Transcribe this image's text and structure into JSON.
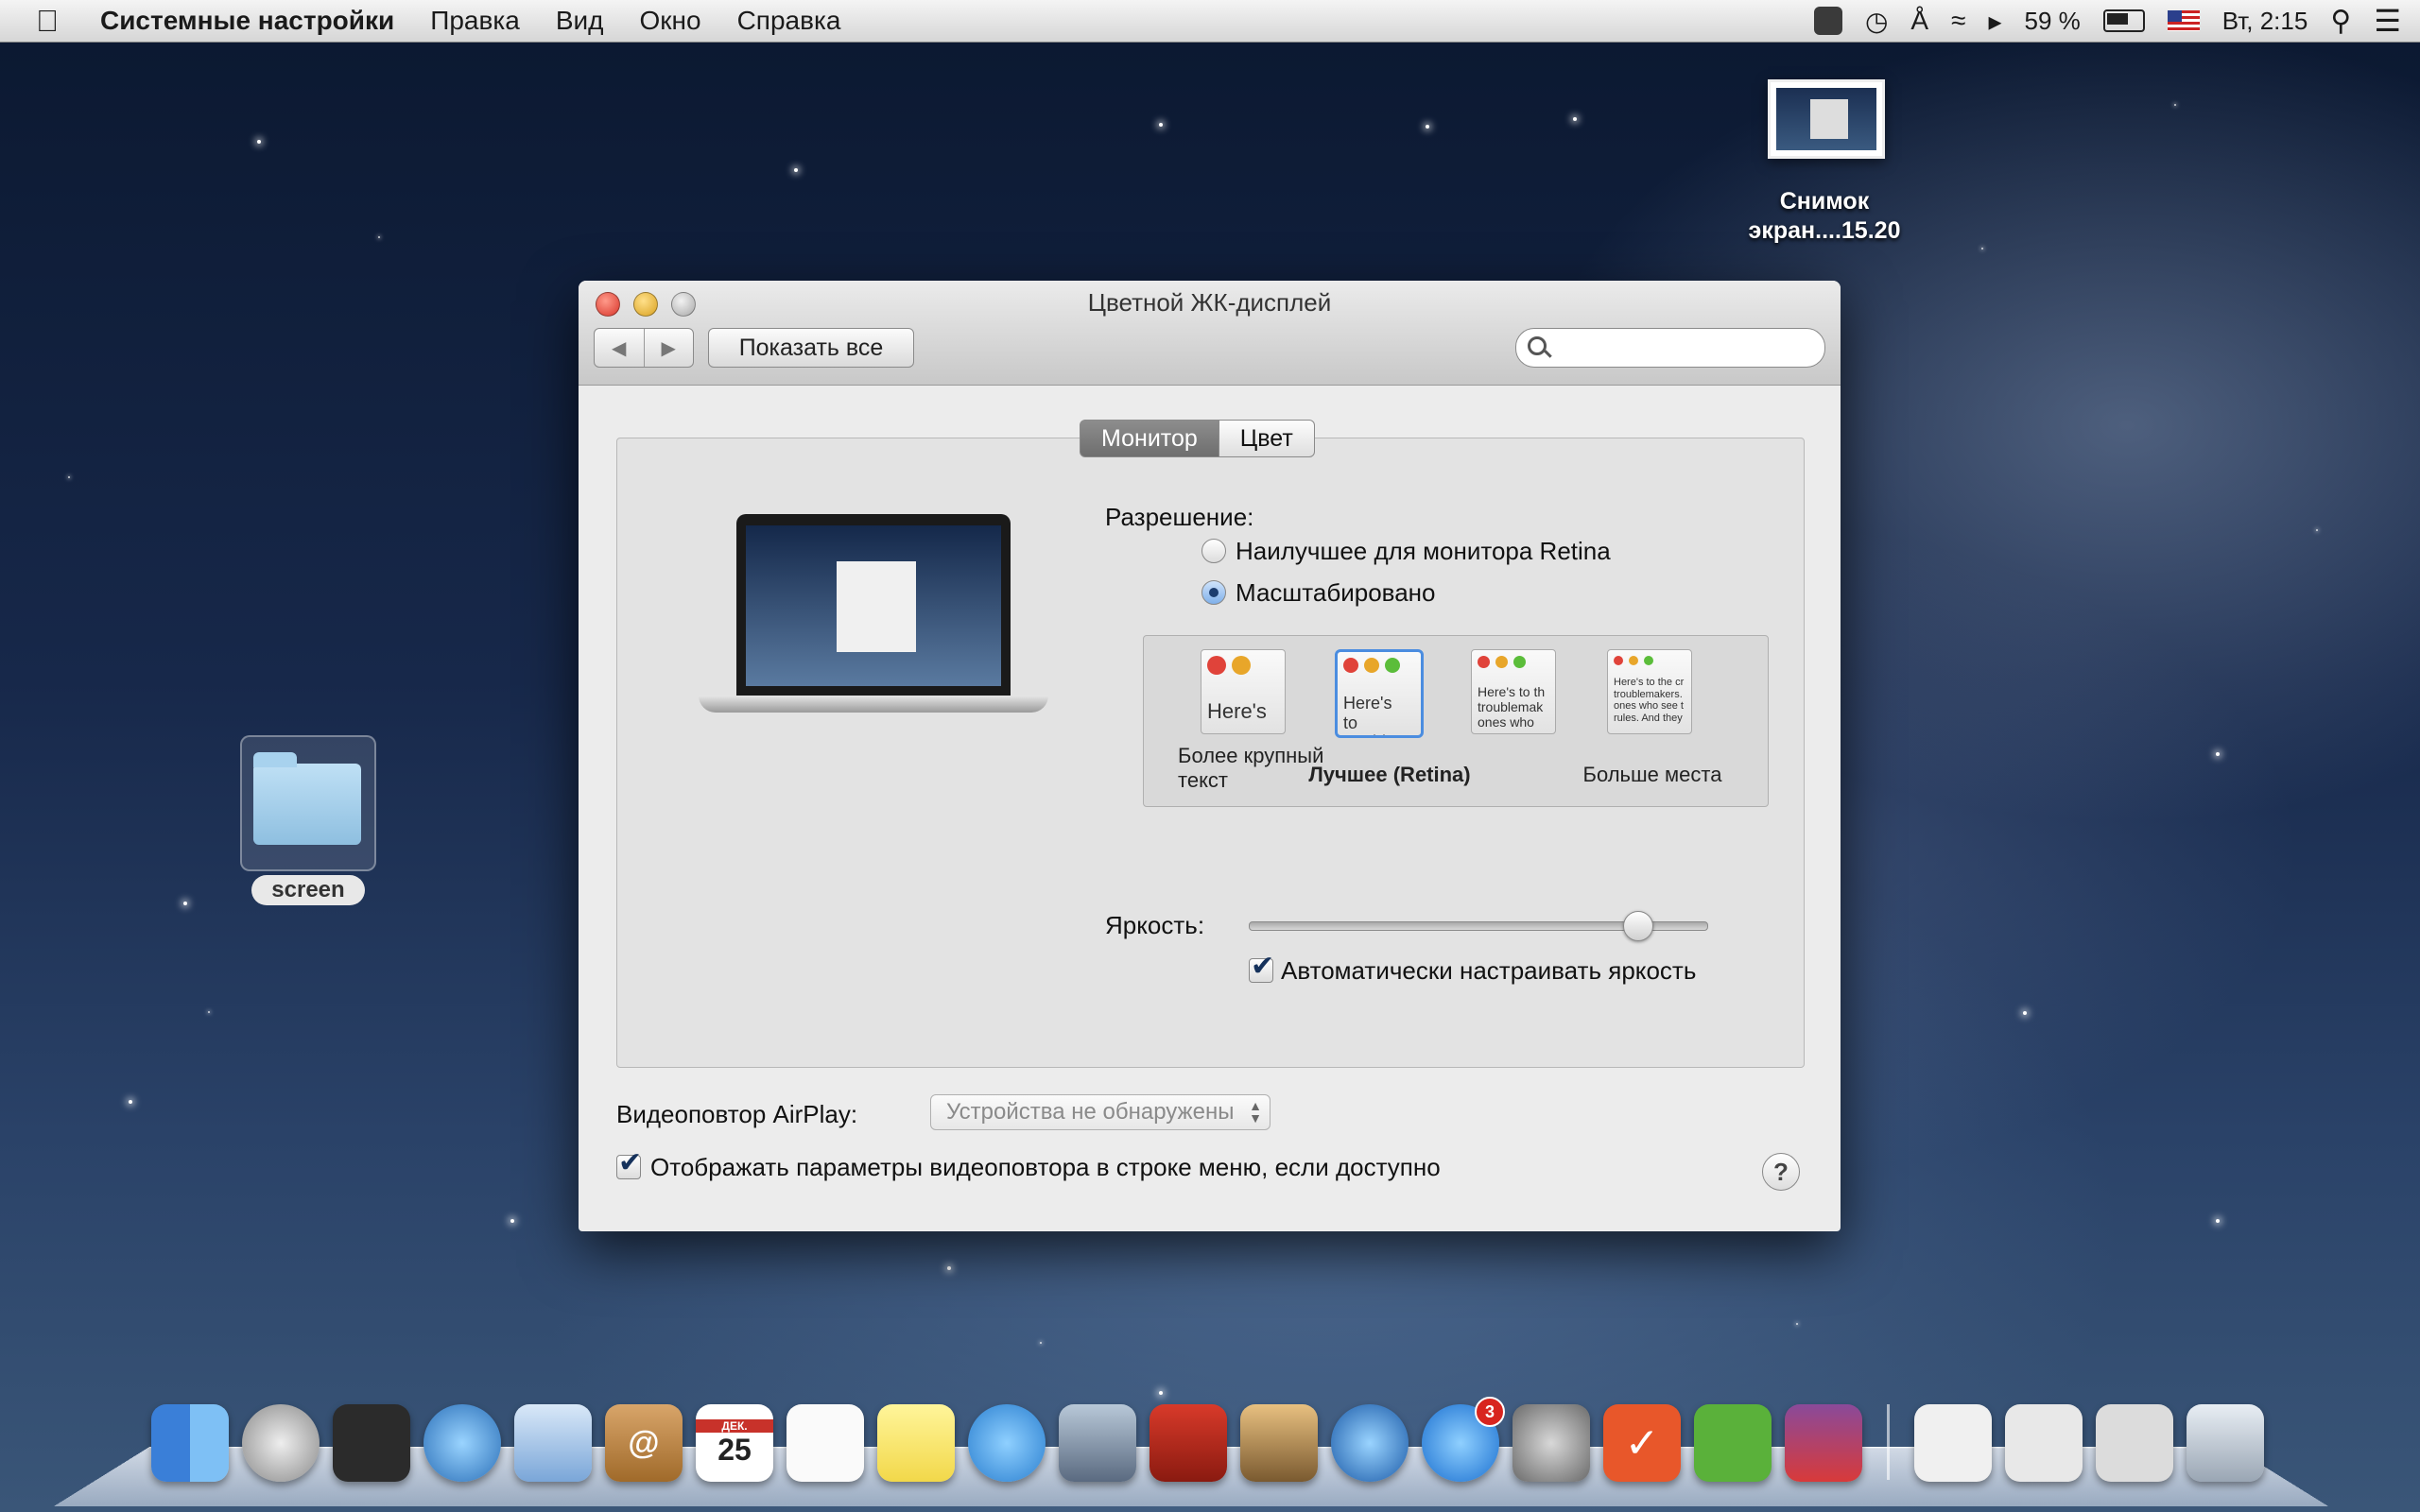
{
  "menubar": {
    "app_name": "Системные настройки",
    "menus": [
      "Правка",
      "Вид",
      "Окно",
      "Справка"
    ],
    "battery": "59 %",
    "clock": "Вт, 2:15"
  },
  "desktop": {
    "screenshot_label": "Снимок экран....15.20",
    "folder_label": "screen"
  },
  "window": {
    "title": "Цветной ЖК-дисплей",
    "show_all": "Показать все",
    "search_placeholder": "",
    "tabs": [
      "Монитор",
      "Цвет"
    ],
    "resolution_label": "Разрешение:",
    "radio_best": "Наилучшее для монитора Retina",
    "radio_scaled": "Масштабировано",
    "scale_options": [
      {
        "label": "Более крупный текст",
        "preview": "Here's"
      },
      {
        "label": "Лучшее (Retina)",
        "preview": "Here's to troublem"
      },
      {
        "label": "",
        "preview": "Here's to th troublemak ones who"
      },
      {
        "label": "Больше места",
        "preview": "Here's to the cr troublemakers. ones who see t rules. And they"
      }
    ],
    "brightness_label": "Яркость:",
    "brightness_value": 0.87,
    "auto_brightness": "Автоматически настраивать яркость",
    "airplay_label": "Видеоповтор AirPlay:",
    "airplay_value": "Устройства не обнаружены",
    "show_mirroring": "Отображать параметры видеоповтора в строке меню, если доступно",
    "help": "?"
  },
  "dock": {
    "calendar_month": "ДЕК.",
    "calendar_day": "25",
    "appstore_badge": "3"
  }
}
